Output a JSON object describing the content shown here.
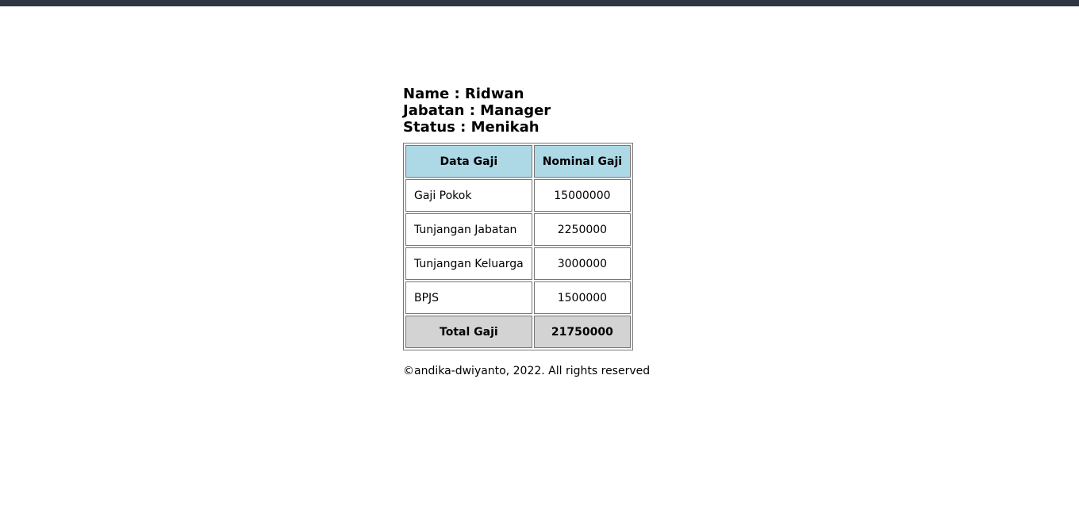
{
  "colors": {
    "topbar": "#2f3542",
    "header_bg": "#add8e6",
    "total_bg": "#d3d3d3"
  },
  "employee": {
    "name_line": "Name : Ridwan",
    "position_line": "Jabatan : Manager",
    "status_line": "Status : Menikah"
  },
  "table": {
    "headers": [
      "Data Gaji",
      "Nominal Gaji"
    ],
    "rows": [
      {
        "label": "Gaji Pokok",
        "value": "15000000"
      },
      {
        "label": "Tunjangan Jabatan",
        "value": "2250000"
      },
      {
        "label": "Tunjangan Keluarga",
        "value": "3000000"
      },
      {
        "label": "BPJS",
        "value": "1500000"
      }
    ],
    "total": {
      "label": "Total Gaji",
      "value": "21750000"
    }
  },
  "footer": {
    "text": "©andika-dwiyanto, 2022. All rights reserved"
  }
}
